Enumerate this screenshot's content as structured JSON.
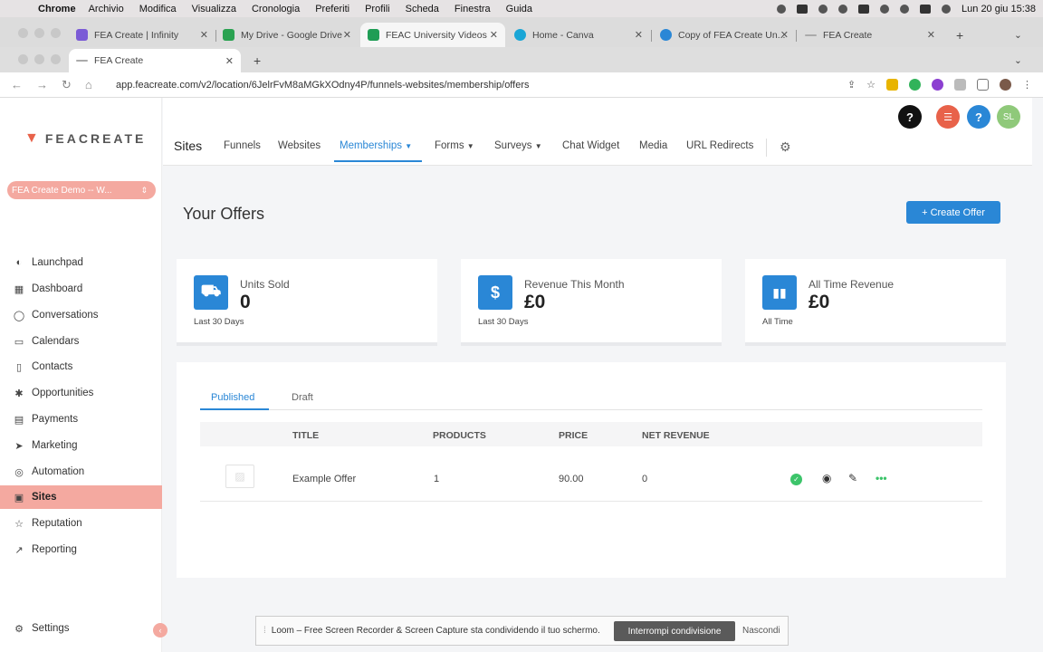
{
  "macos": {
    "app": "Chrome",
    "menus": [
      "Archivio",
      "Modifica",
      "Visualizza",
      "Cronologia",
      "Preferiti",
      "Profili",
      "Scheda",
      "Finestra",
      "Guida"
    ],
    "clock": "Lun 20 giu  15:38"
  },
  "browser_window_1": {
    "tabs": [
      {
        "title": "FEA Create | Infinity",
        "color": "#7b5bd6"
      },
      {
        "title": "My Drive - Google Drive",
        "color": "#2aa251"
      },
      {
        "title": "FEAC University Videos",
        "color": "#1f9d55"
      },
      {
        "title": "Home - Canva",
        "color": "#1aa6d6"
      },
      {
        "title": "Copy of FEA Create Un...",
        "color": "#2a87d6"
      },
      {
        "title": "FEA Create",
        "color": "#aaaaaa"
      }
    ],
    "new_tab": "+"
  },
  "browser_window_2": {
    "tab_title": "FEA Create",
    "new_tab": "+",
    "url": "app.feacreate.com/v2/location/6JelrFvM8aMGkXOdny4P/funnels-websites/membership/offers"
  },
  "sidebar": {
    "logo_text": "FEACREATE",
    "location": "FEA Create Demo -- W...",
    "items": [
      {
        "label": "Launchpad",
        "icon": "rocket-icon"
      },
      {
        "label": "Dashboard",
        "icon": "dashboard-icon"
      },
      {
        "label": "Conversations",
        "icon": "chat-icon"
      },
      {
        "label": "Calendars",
        "icon": "calendar-icon"
      },
      {
        "label": "Contacts",
        "icon": "contacts-icon"
      },
      {
        "label": "Opportunities",
        "icon": "opportunities-icon"
      },
      {
        "label": "Payments",
        "icon": "payments-icon"
      },
      {
        "label": "Marketing",
        "icon": "marketing-icon"
      },
      {
        "label": "Automation",
        "icon": "automation-icon"
      },
      {
        "label": "Sites",
        "icon": "sites-icon",
        "active": true
      },
      {
        "label": "Reputation",
        "icon": "star-icon"
      },
      {
        "label": "Reporting",
        "icon": "reporting-icon"
      }
    ],
    "settings": "Settings"
  },
  "topnav": {
    "section": "Sites",
    "items": [
      "Funnels",
      "Websites",
      "Memberships",
      "Forms",
      "Surveys",
      "Chat Widget",
      "Media",
      "URL Redirects"
    ],
    "active": "Memberships",
    "avatar": "SL",
    "help": "?"
  },
  "page": {
    "title": "Your Offers",
    "create_button": "+ Create Offer"
  },
  "stats": [
    {
      "label": "Units Sold",
      "value": "0",
      "sub": "Last 30 Days",
      "icon": "cart-icon"
    },
    {
      "label": "Revenue This Month",
      "value": "£0",
      "sub": "Last 30 Days",
      "icon": "dollar-icon"
    },
    {
      "label": "All Time Revenue",
      "value": "£0",
      "sub": "All Time",
      "icon": "bar-chart-icon"
    }
  ],
  "offers": {
    "tabs": [
      "Published",
      "Draft"
    ],
    "active_tab": "Published",
    "columns": [
      "TITLE",
      "PRODUCTS",
      "PRICE",
      "NET REVENUE"
    ],
    "rows": [
      {
        "title": "Example Offer",
        "products": "1",
        "price": "90.00",
        "net_revenue": "0"
      }
    ]
  },
  "loom": {
    "message": "Loom – Free Screen Recorder & Screen Capture sta condividendo il tuo schermo.",
    "stop": "Interrompi condivisione",
    "hide": "Nascondi"
  }
}
